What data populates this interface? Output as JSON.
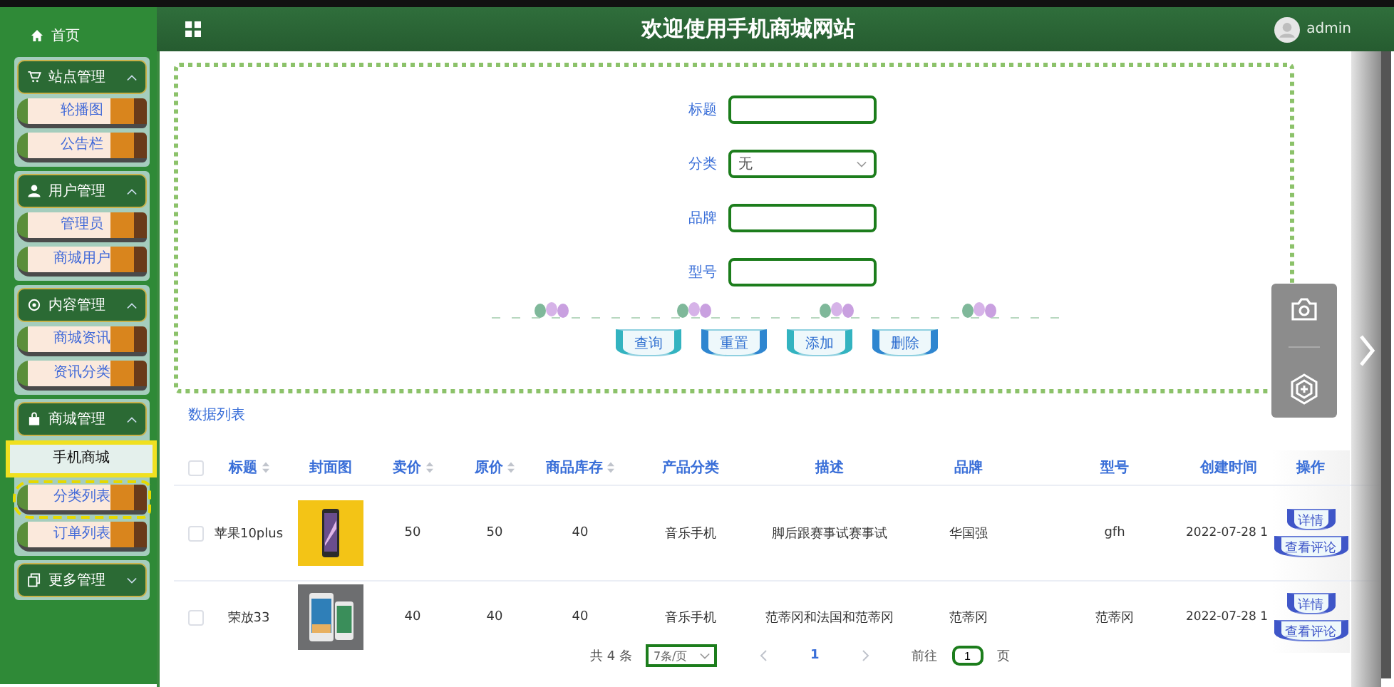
{
  "header": {
    "title": "欢迎使用手机商城网站",
    "user": "admin"
  },
  "sidebar": {
    "home": "首页",
    "groups": [
      {
        "label": "站点管理",
        "kind": "cart",
        "expanded": true,
        "children": [
          {
            "label": "轮播图",
            "selected": false,
            "hovered": false
          },
          {
            "label": "公告栏",
            "selected": false,
            "hovered": false
          }
        ]
      },
      {
        "label": "用户管理",
        "kind": "user",
        "expanded": true,
        "children": [
          {
            "label": "管理员",
            "selected": false,
            "hovered": false
          },
          {
            "label": "商城用户",
            "selected": false,
            "hovered": false
          }
        ]
      },
      {
        "label": "内容管理",
        "kind": "circle",
        "expanded": true,
        "children": [
          {
            "label": "商城资讯",
            "selected": false,
            "hovered": false
          },
          {
            "label": "资讯分类",
            "selected": false,
            "hovered": false
          }
        ]
      },
      {
        "label": "商城管理",
        "kind": "bag",
        "expanded": true,
        "children": [
          {
            "label": "手机商城",
            "selected": true,
            "hovered": false
          },
          {
            "label": "分类列表",
            "selected": false,
            "hovered": true
          },
          {
            "label": "订单列表",
            "selected": false,
            "hovered": false
          }
        ]
      },
      {
        "label": "更多管理",
        "kind": "copy",
        "expanded": false
      }
    ]
  },
  "search": {
    "fields": [
      {
        "kind": "input",
        "label": "标题"
      },
      {
        "kind": "select",
        "label": "分类",
        "value": "无"
      },
      {
        "kind": "input",
        "label": "品牌"
      },
      {
        "kind": "input",
        "label": "型号"
      }
    ],
    "buttons": [
      "查询",
      "重置",
      "添加",
      "删除"
    ]
  },
  "table": {
    "caption": "数据列表",
    "columns": [
      {
        "label": "标题",
        "sortable": true
      },
      {
        "label": "封面图",
        "sortable": false
      },
      {
        "label": "卖价",
        "sortable": true
      },
      {
        "label": "原价",
        "sortable": true
      },
      {
        "label": "商品库存",
        "sortable": true
      },
      {
        "label": "产品分类",
        "sortable": false
      },
      {
        "label": "描述",
        "sortable": false
      },
      {
        "label": "品牌",
        "sortable": false
      },
      {
        "label": "型号",
        "sortable": false
      },
      {
        "label": "创建时间",
        "sortable": false
      },
      {
        "label": "操作",
        "sortable": false
      }
    ],
    "select_all": {
      "checked": false
    },
    "rows": [
      {
        "checked": false,
        "cells": [
          "苹果10plus",
          {
            "kind": "picture"
          },
          "50",
          "50",
          "40",
          "音乐手机",
          "脚后跟赛事试赛事试",
          "华国强",
          "gfh",
          "2022-07-28 1",
          {
            "actions": [
              "详情",
              "查看评论"
            ]
          }
        ]
      },
      {
        "checked": false,
        "cells": [
          "荣放33",
          {
            "kind": "picture"
          },
          "40",
          "40",
          "40",
          "音乐手机",
          "范蒂冈和法国和范蒂冈",
          "范蒂冈",
          "范蒂冈",
          "2022-07-28 1",
          {
            "actions": [
              "详情",
              "查看评论"
            ]
          }
        ]
      }
    ]
  },
  "pagination": {
    "total": "共 4 条",
    "page_size": "7条/页",
    "pages": [
      {
        "label": "1",
        "selected": true
      }
    ],
    "goto_label": "前往",
    "goto_value": "1",
    "goto_suffix": "页"
  }
}
